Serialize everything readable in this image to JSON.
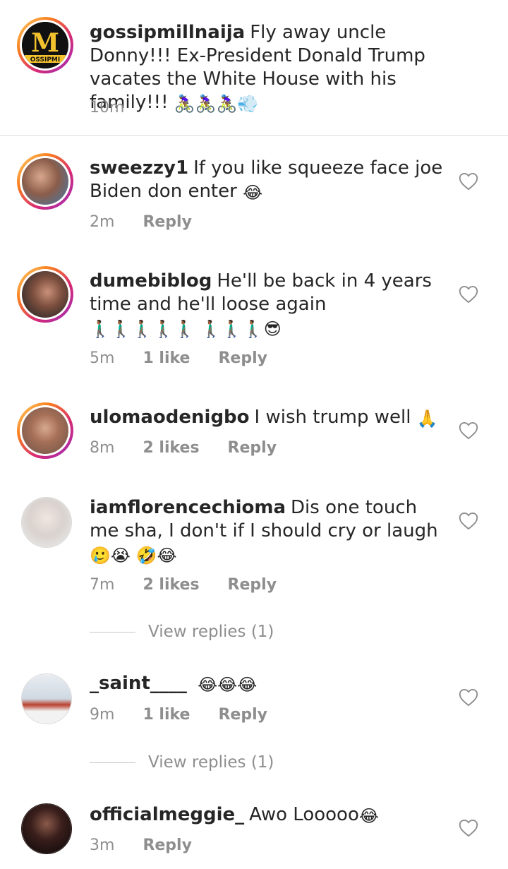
{
  "caption": {
    "username": "gossipmillnaija",
    "text": "Fly away uncle Donny!!! Ex-President Donald Trump vacates the White House with his family!!!",
    "emoji": "🚴🏾‍♀️🚴🏾‍♀️🚴🏾‍♀️💨",
    "time": "10m",
    "avatar_letter": "M",
    "avatar_tag": "OSSIPMI"
  },
  "comments": [
    {
      "username": "sweezzy1",
      "text": "If you like squeeze face joe Biden don enter",
      "emoji": "😂",
      "time": "2m",
      "likes": "",
      "reply": "Reply"
    },
    {
      "username": "dumebiblog",
      "text": "He'll be back in 4 years time and he'll loose again",
      "emoji": "🚶🏾‍♂️🚶🏾‍♂️🚶🏾‍♂️🚶🏾‍♂️🚶🏾‍♂️ 🚶🏾‍♂️🚶🏾‍♂️🚶🏾‍♂️😎",
      "time": "5m",
      "likes": "1 like",
      "reply": "Reply"
    },
    {
      "username": "ulomaodenigbo",
      "text": "I wish trump well",
      "emoji": "🙏",
      "time": "8m",
      "likes": "2 likes",
      "reply": "Reply"
    },
    {
      "username": "iamflorencechioma",
      "text": "Dis one touch me sha, I don't if I should cry or laugh",
      "emoji": "🥲😭 🤣😂",
      "time": "7m",
      "likes": "2 likes",
      "reply": "Reply"
    },
    {
      "username": "_saint____",
      "text": "",
      "emoji": "😂😂😂",
      "time": "9m",
      "likes": "1 like",
      "reply": "Reply"
    },
    {
      "username": "officialmeggie_",
      "text": "Awo Looooo",
      "emoji": "😂",
      "time": "3m",
      "likes": "",
      "reply": "Reply"
    }
  ],
  "view_replies": [
    "View replies (1)",
    "View replies (1)"
  ],
  "colors": {
    "text": "#262626",
    "muted": "#8e8e8e",
    "divider": "#dbdbdb"
  },
  "icons": {
    "like": "heart-outline-icon"
  }
}
